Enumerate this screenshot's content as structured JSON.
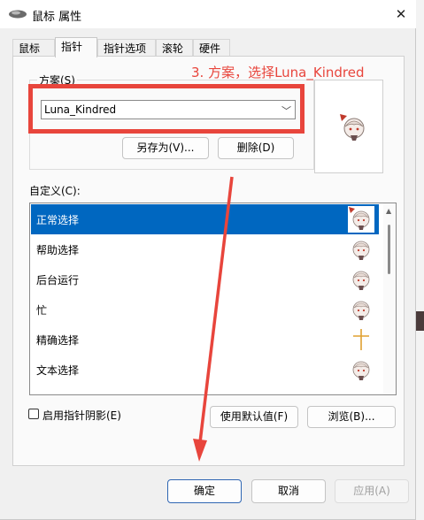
{
  "window": {
    "title": "鼠标 属性",
    "close_glyph": "✕"
  },
  "tabs": [
    {
      "label": "鼠标键"
    },
    {
      "label": "指针"
    },
    {
      "label": "指针选项"
    },
    {
      "label": "滚轮"
    },
    {
      "label": "硬件"
    }
  ],
  "active_tab": "指针",
  "scheme": {
    "group_label": "方案(S)",
    "selected": "Luna_Kindred",
    "save_as_label": "另存为(V)...",
    "delete_label": "删除(D)"
  },
  "customize": {
    "label": "自定义(C):",
    "items": [
      {
        "label": "正常选择",
        "cursor_icon": "anime-girl-cursor-icon",
        "selected": true
      },
      {
        "label": "帮助选择",
        "cursor_icon": "anime-girl-cursor-icon"
      },
      {
        "label": "后台运行",
        "cursor_icon": "anime-girl-cursor-icon"
      },
      {
        "label": "忙",
        "cursor_icon": "anime-girl-cursor-icon"
      },
      {
        "label": "精确选择",
        "cursor_icon": "crosshair-icon"
      },
      {
        "label": "文本选择",
        "cursor_icon": "anime-girl-cursor-icon"
      }
    ]
  },
  "shadow_checkbox": {
    "label": "启用指针阴影(E)",
    "checked": false
  },
  "buttons": {
    "use_default": "使用默认值(F)",
    "browse": "浏览(B)...",
    "ok": "确定",
    "cancel": "取消",
    "apply": "应用(A)"
  },
  "annotation": {
    "text": "3. 方案，选择Luna_Kindred",
    "color": "#e8453c"
  },
  "colors": {
    "selection": "#0067c0",
    "annotation": "#e8453c"
  }
}
